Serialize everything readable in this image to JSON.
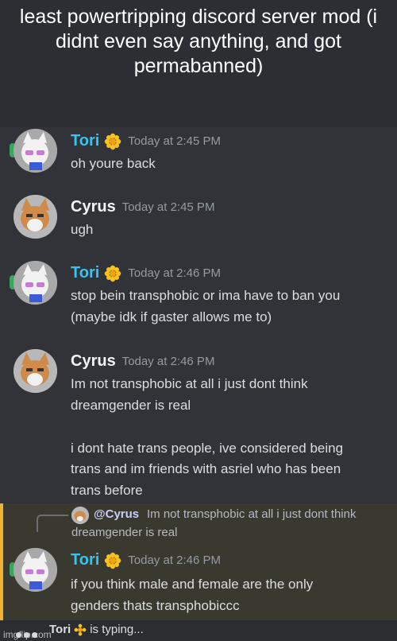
{
  "meme": {
    "caption": "least powertripping discord server mod (i didnt even say anything, and got permabanned)"
  },
  "colors": {
    "tori_name": "#36c4f2",
    "cyrus_name": "#f2f3f5",
    "highlight_bar": "#f0b232",
    "chat_bg": "#313338"
  },
  "messages": [
    {
      "author": "Tori",
      "badge": "flower-icon",
      "timestamp": "Today at 2:45 PM",
      "lines": [
        "oh youre back"
      ]
    },
    {
      "author": "Cyrus",
      "timestamp": "Today at 2:45 PM",
      "lines": [
        "ugh"
      ]
    },
    {
      "author": "Tori",
      "badge": "flower-icon",
      "timestamp": "Today at 2:46 PM",
      "lines": [
        "stop bein transphobic or ima have to ban you",
        "(maybe idk if gaster allows me to)"
      ]
    },
    {
      "author": "Cyrus",
      "timestamp": "Today at 2:46 PM",
      "lines": [
        "Im not transphobic at all i just dont think",
        "dreamgender is real",
        "i dont hate trans people, ive considered being",
        "trans and im friends with asriel who has been",
        "trans before"
      ]
    },
    {
      "author": "Tori",
      "badge": "flower-icon",
      "timestamp": "Today at 2:46 PM",
      "reply": {
        "mention": "@Cyrus",
        "text_line1": "Im not transphobic at all i just dont think",
        "text_line2": "dreamgender is real"
      },
      "lines": [
        "if you think male and female are the only",
        "genders thats transphobiccc"
      ]
    }
  ],
  "typing": {
    "user": "Tori",
    "suffix": "is typing..."
  },
  "watermark": "imgflip.com"
}
